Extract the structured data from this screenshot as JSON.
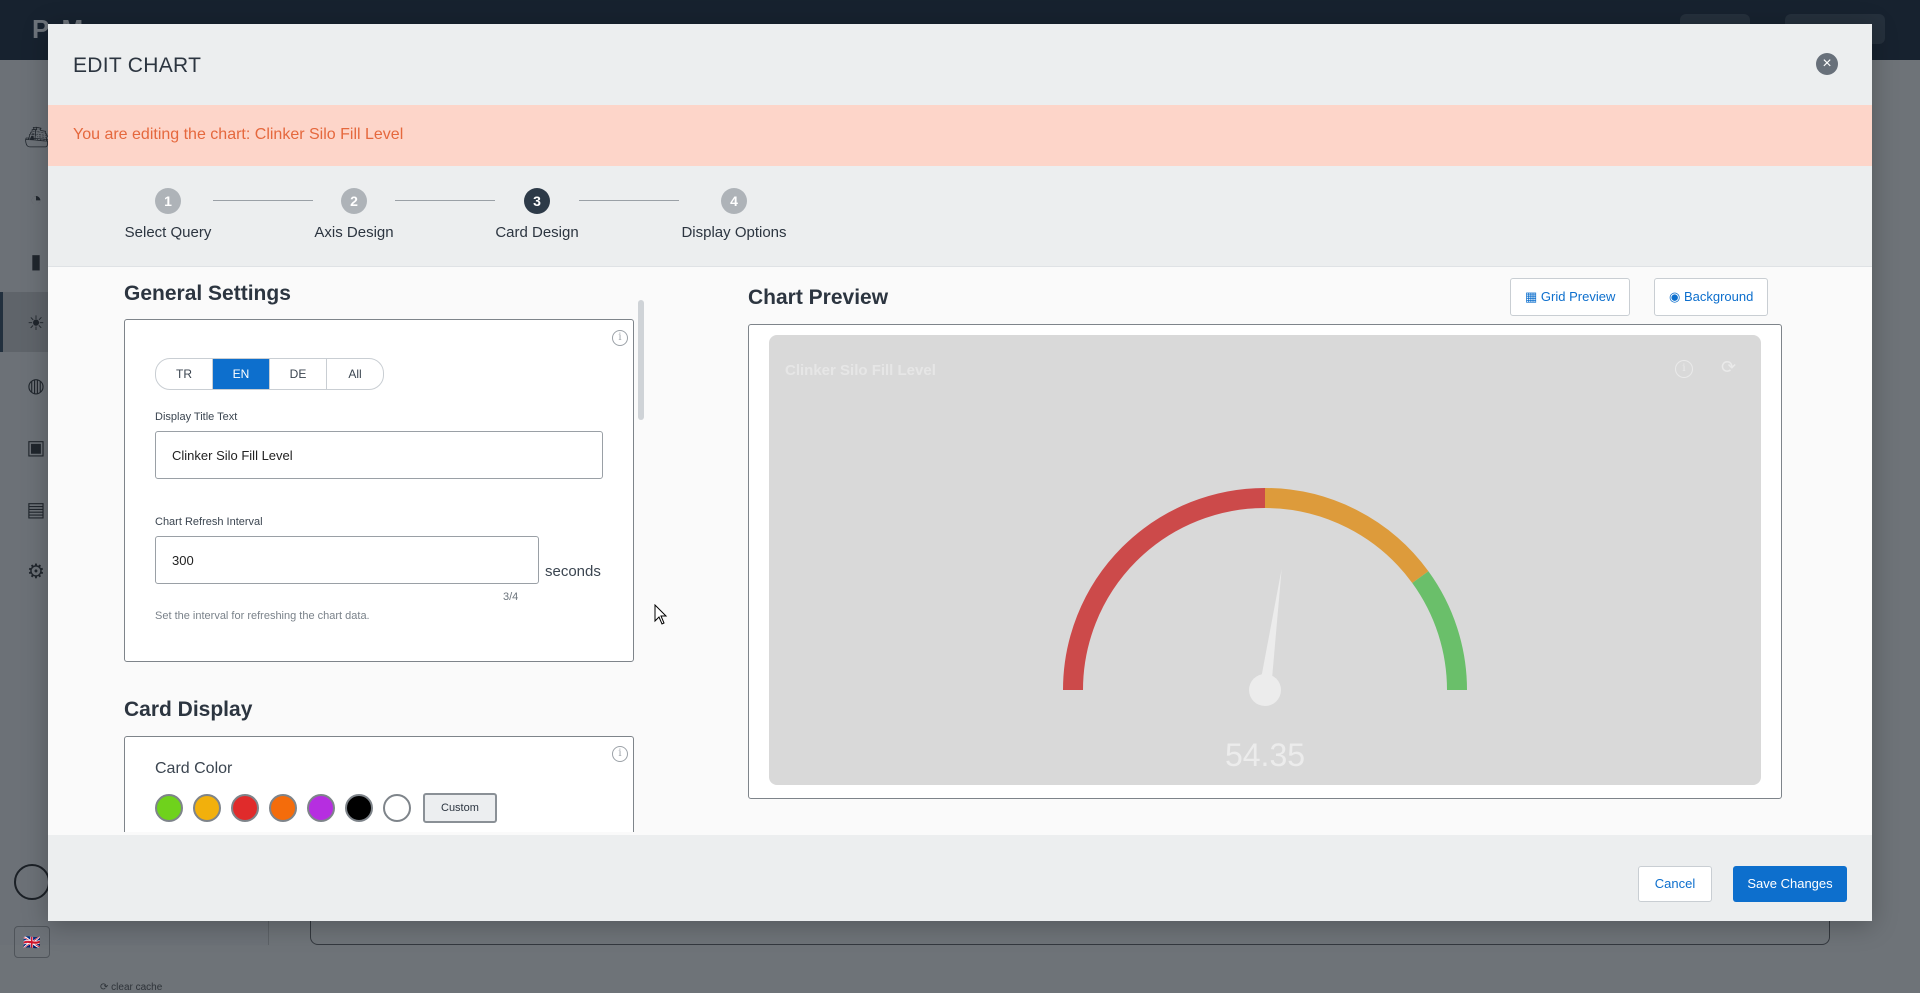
{
  "background_app": {
    "logo": "PrM",
    "clear_cache": "clear cache"
  },
  "modal": {
    "title": "EDIT CHART",
    "alert": "You are editing the chart: Clinker Silo Fill Level",
    "steps": [
      {
        "number": "1",
        "label": "Select Query"
      },
      {
        "number": "2",
        "label": "Axis Design"
      },
      {
        "number": "3",
        "label": "Card Design"
      },
      {
        "number": "4",
        "label": "Display Options"
      }
    ],
    "active_step": 3
  },
  "general_settings": {
    "title": "General Settings",
    "languages": [
      "TR",
      "EN",
      "DE",
      "All"
    ],
    "selected_language": "EN",
    "display_title_label": "Display Title Text",
    "display_title_value": "Clinker Silo Fill Level",
    "refresh_label": "Chart Refresh Interval",
    "refresh_value": "300",
    "refresh_unit": "seconds",
    "refresh_counter": "3/4",
    "refresh_hint": "Set the interval for refreshing the chart data."
  },
  "card_display": {
    "title": "Card Display",
    "color_label": "Card Color",
    "colors": [
      "#6fd21c",
      "#f2b00c",
      "#e02b2b",
      "#f46c0b",
      "#b62ee0",
      "#000000",
      "#ffffff"
    ],
    "custom_label": "Custom"
  },
  "chart_preview": {
    "title": "Chart Preview",
    "grid_preview_label": "Grid Preview",
    "background_label": "Background",
    "card_title": "Clinker Silo Fill Level",
    "value_display": "54.35"
  },
  "chart_data": {
    "type": "gauge",
    "value": 54.35,
    "range": [
      0,
      100
    ],
    "bands": [
      {
        "from": 0,
        "to": 50,
        "color": "#cc4a4a"
      },
      {
        "from": 50,
        "to": 80,
        "color": "#dd9b3b"
      },
      {
        "from": 80,
        "to": 100,
        "color": "#6abf6a"
      }
    ],
    "needle_color": "#ececec",
    "card_background": "#d9d9d9"
  },
  "footer": {
    "cancel_label": "Cancel",
    "save_label": "Save Changes"
  }
}
